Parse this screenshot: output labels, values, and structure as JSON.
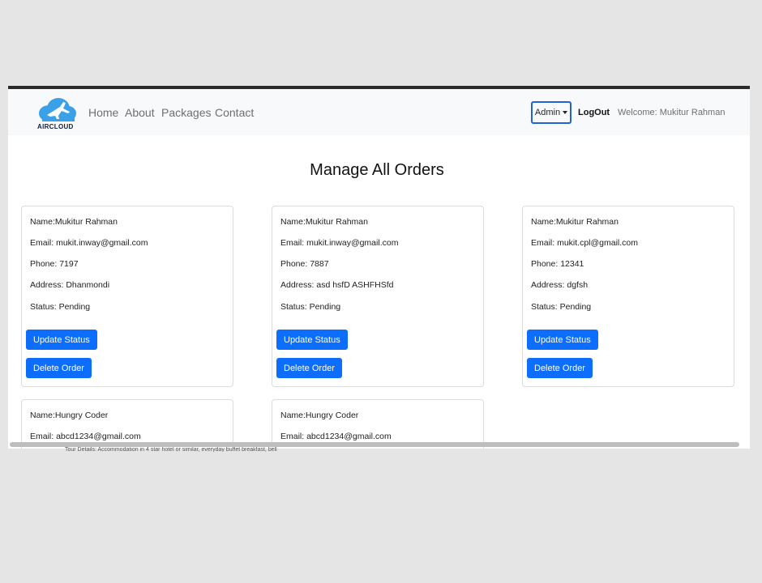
{
  "brand": {
    "name": "AIRCLOUD"
  },
  "nav": {
    "links": [
      "Home",
      "About",
      "Packages",
      "Contact"
    ]
  },
  "user": {
    "admin_label": "Admin",
    "logout_label": "LogOut",
    "welcome_text": "Welcome: Mukitur Rahman"
  },
  "page": {
    "title": "Manage All Orders"
  },
  "buttons": {
    "update": "Update Status",
    "delete": "Delete Order"
  },
  "orders": [
    {
      "name": "Name:Mukitur Rahman",
      "email": "Email: mukit.inway@gmail.com",
      "phone": "Phone: 7197",
      "address": "Address: Dhanmondi",
      "status": "Status: Pending"
    },
    {
      "name": "Name:Mukitur Rahman",
      "email": "Email: mukit.inway@gmail.com",
      "phone": "Phone: 7887",
      "address": "Address: asd hsfD ASHFHSfd",
      "status": "Status: Pending"
    },
    {
      "name": "Name:Mukitur Rahman",
      "email": "Email: mukit.cpl@gmail.com",
      "phone": "Phone: 12341",
      "address": "Address: dgfsh",
      "status": "Status: Pending"
    },
    {
      "name": "Name:Hungry Coder",
      "email": "Email: abcd1234@gmail.com"
    },
    {
      "name": "Name:Hungry Coder",
      "email": "Email: abcd1234@gmail.com"
    }
  ],
  "peek_text": "Tour Details: Accommodation in 4 star hotel or similar, everyday buffet breakfast, bell"
}
